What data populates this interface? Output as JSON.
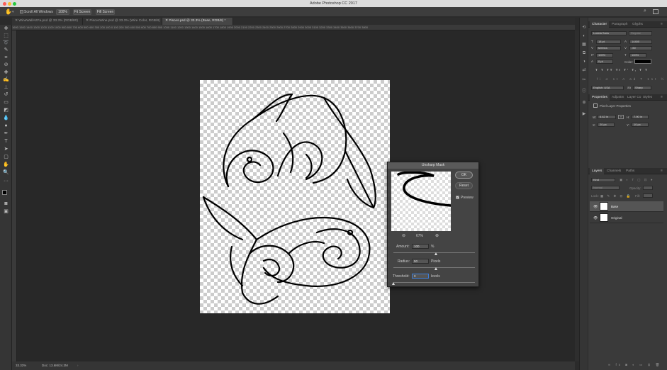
{
  "app": {
    "window_title": "Adobe Photoshop CC 2017"
  },
  "options_bar": {
    "scroll_all_label": "Scroll All Windows",
    "zoom_label": "100%",
    "fit_screen_label": "Fit Screen",
    "fill_screen_label": "Fill Screen"
  },
  "tabs": [
    {
      "label": "WineWallArtFa.psd @ 33.3% (RGB/8#)"
    },
    {
      "label": "PiscesWine.psd @ 33.3% (Wire Color, RGB/8)"
    },
    {
      "label": "Pisces.psd @ 33.3% (Base, RGB/8) *"
    }
  ],
  "ruler_h_text": "1600 1500 1400 1300 1200 1100 1000  900  800  700  600  500  400  300  200  100    0   100  200  300  400  500  600  700  800  900 1000 1100 1200 1300 1400 1500 1600 1700 1800 1900 2000 2100 2200 2300 2400 2500 2600 2700 2800 2900 3000 3100 3200 3300 3400 3500 3600 3700 3800",
  "status": {
    "zoom": "33.33%",
    "doc": "Doc: 13.6M/24.3M"
  },
  "character_panel": {
    "tabs": [
      "Character",
      "Paragraph",
      "Glyphs"
    ],
    "font_family": "Lucida Sans",
    "font_style": "Regular",
    "size": "18 pt",
    "leading": "14400",
    "kerning": "Metrics",
    "tracking": "-50",
    "vscale": "100%",
    "hscale": "100%",
    "baseline": "0 pt",
    "color_label": "Color:",
    "language": "English: USA",
    "antialias": "Sharp"
  },
  "properties_panel": {
    "tabs": [
      "Properties",
      "Adjustm",
      "Layer Co",
      "Styles"
    ],
    "title": "Pixel Layer Properties",
    "w_label": "W:",
    "w_value": "6.42 in",
    "h_label": "H:",
    "h_value": "7.90 in",
    "x_label": "X:",
    "x_value": "20 px",
    "y_label": "Y:",
    "y_value": "10 px"
  },
  "layers_panel": {
    "tabs": [
      "Layers",
      "Channels",
      "Paths"
    ],
    "kind_label": "Kind",
    "blend_mode": "Normal",
    "opacity_label": "Opacity:",
    "lock_label": "Lock:",
    "fill_label": "Fill:",
    "layers": [
      {
        "name": "Base",
        "selected": true
      },
      {
        "name": "Original",
        "selected": false
      }
    ]
  },
  "dialog": {
    "title": "Unsharp Mask",
    "ok_label": "OK",
    "reset_label": "Reset",
    "preview_label": "Preview",
    "preview_checked": true,
    "zoom": "67%",
    "amount_label": "Amount:",
    "amount_value": "100",
    "amount_unit": "%",
    "radius_label": "Radius:",
    "radius_value": "50",
    "radius_unit": "Pixels",
    "threshold_label": "Threshold:",
    "threshold_value": "0",
    "threshold_unit": "levels"
  },
  "colors": {
    "accent": "#3f7fd9",
    "dialog_bg": "#444444",
    "panel_bg": "#3a3a3a"
  }
}
